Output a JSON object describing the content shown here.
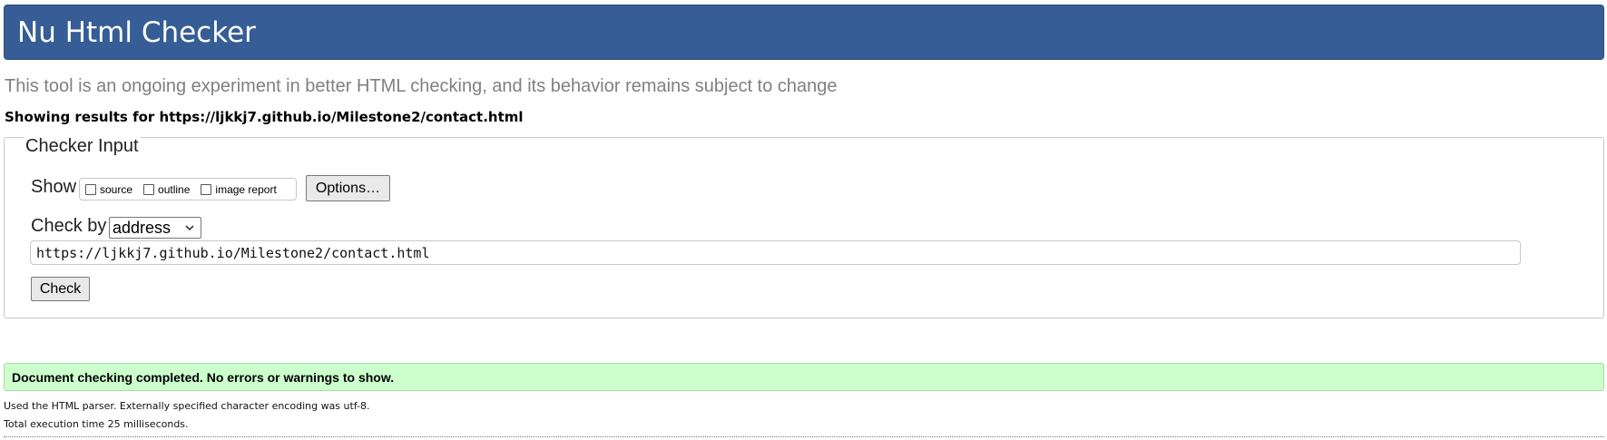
{
  "header": {
    "title": "Nu Html Checker"
  },
  "subtitle": "This tool is an ongoing experiment in better HTML checking, and its behavior remains subject to change",
  "showing": {
    "prefix": "Showing results for ",
    "url": "https://ljkkj7.github.io/Milestone2/contact.html"
  },
  "checker_input": {
    "legend": "Checker Input",
    "show_label": "Show",
    "options": [
      {
        "label": "source",
        "checked": false
      },
      {
        "label": "outline",
        "checked": false
      },
      {
        "label": "image report",
        "checked": false
      }
    ],
    "options_button": "Options…",
    "check_by_label": "Check by",
    "check_by_value": "address",
    "url_value": "https://ljkkj7.github.io/Milestone2/contact.html",
    "check_button": "Check"
  },
  "result": {
    "message": "Document checking completed. No errors or warnings to show.",
    "parser_info": "Used the HTML parser. Externally specified character encoding was utf-8.",
    "execution_time": "Total execution time 25 milliseconds."
  },
  "colors": {
    "header_bg": "#365d95",
    "success_bg": "#ccffcc",
    "subtitle_text": "#808080"
  }
}
